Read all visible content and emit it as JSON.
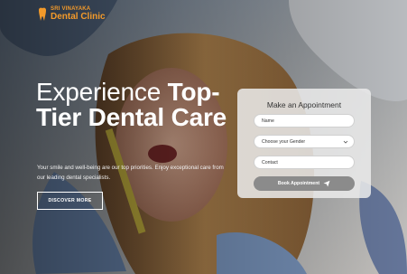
{
  "brand": {
    "line1": "SRI VINAYAKA",
    "line2": "Dental Clinic",
    "icon": "tooth-logo-icon"
  },
  "hero": {
    "headline_regular": "Experience ",
    "headline_bold": "Top-Tier Dental Care",
    "subtext": "Your smile and well-being are our top priorities. Enjoy exceptional care from our leading dental specialists.",
    "cta_label": "DISCOVER MORE"
  },
  "appointment_form": {
    "title": "Make an Appointment",
    "name_label": "Name",
    "gender_label": "Choose your Gender",
    "contact_label": "Contact",
    "submit_label": "Book Appointment",
    "submit_icon": "send-icon"
  },
  "colors": {
    "brand_orange": "#f39a2a",
    "button_gray": "#8b8b8b",
    "panel_bg": "#ebebeb"
  }
}
